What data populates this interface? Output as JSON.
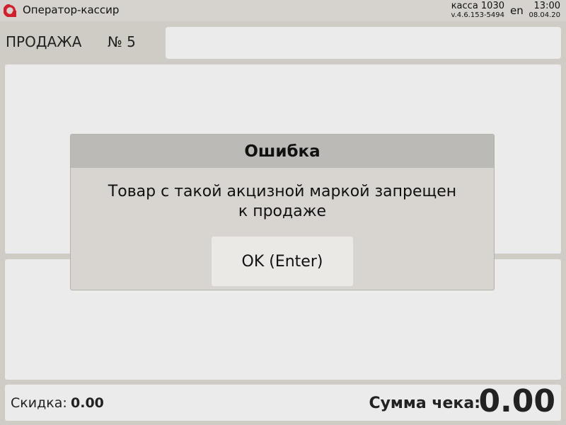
{
  "app": {
    "title": "Оператор-кассир",
    "logo_color": "#d0202e"
  },
  "status": {
    "register": "касса 1030",
    "version": "v.4.6.153-5494",
    "language": "en",
    "time": "13:00",
    "date": "08.04.20"
  },
  "sale": {
    "title": "ПРОДАЖА",
    "number": "№ 5"
  },
  "footer": {
    "discount_label": "Скидка:",
    "discount_value": "0.00",
    "total_label": "Сумма чека:",
    "total_value": "0.00"
  },
  "dialog": {
    "title": "Ошибка",
    "message_line1": "Товар с такой акцизной маркой запрещен",
    "message_line2": "к продаже",
    "ok_label": "OK (Enter)"
  }
}
